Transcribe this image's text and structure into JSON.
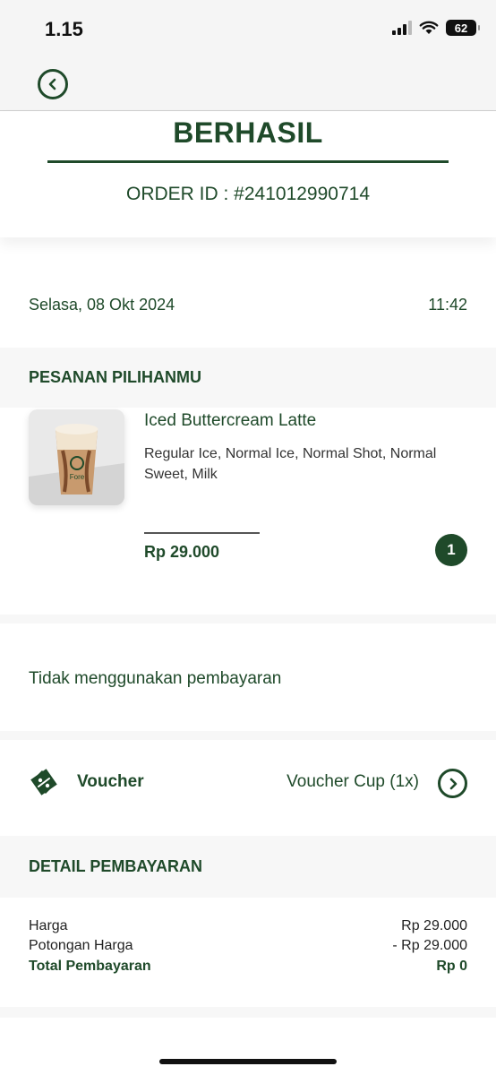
{
  "status_bar": {
    "time": "1.15",
    "battery": "62"
  },
  "header": {
    "status_title": "BERHASIL",
    "order_id_prefix": "ORDER ID : ",
    "order_id": "#241012990714"
  },
  "order_info": {
    "date": "Selasa, 08 Okt 2024",
    "time": "11:42"
  },
  "order_section": {
    "title": "PESANAN PILIHANMU",
    "items": [
      {
        "name": "Iced Buttercream Latte",
        "description": "Regular Ice, Normal Ice, Normal Shot, Normal Sweet, Milk",
        "price": "Rp 29.000",
        "quantity": "1",
        "image_logo_text": "Fore"
      }
    ]
  },
  "payment_method": {
    "text": "Tidak menggunakan pembayaran"
  },
  "voucher": {
    "label": "Voucher",
    "value": "Voucher Cup (1x)"
  },
  "payment_detail": {
    "title": "DETAIL PEMBAYARAN",
    "rows": [
      {
        "label": "Harga",
        "value": "Rp 29.000"
      },
      {
        "label": "Potongan Harga",
        "value": "- Rp 29.000"
      },
      {
        "label": "Total Pembayaran",
        "value": "Rp 0"
      }
    ]
  },
  "colors": {
    "primary": "#1f4a2a",
    "section_bg": "#f7f7f7",
    "header_bg": "#f5f5f5"
  },
  "icons": {
    "back": "chevron-left-icon",
    "voucher": "voucher-percent-icon",
    "voucher_action": "chevron-right-icon"
  }
}
